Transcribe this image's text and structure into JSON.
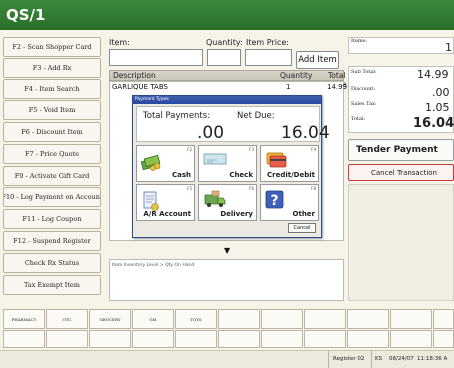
{
  "app": {
    "title": "QS/1"
  },
  "function_keys": [
    "F2 - Scan Shopper Card",
    "F3 - Add Rx",
    "F4 - Item Search",
    "F5 - Void Item",
    "F6 - Discount Item",
    "F7 - Price Quote",
    "F9 - Activate Gift Card",
    "F10 - Log Payment on Account",
    "F11 - Log Coupon",
    "F12 - Suspend Register",
    "Check Rx Status",
    "Tax Exempt Item"
  ],
  "entry": {
    "item_label": "Item:",
    "quantity_label": "Quantity:",
    "price_label": "Item Price:",
    "add_button": "Add Item",
    "item_value": "",
    "quantity_value": "",
    "price_value": ""
  },
  "items_table": {
    "columns": [
      "Description",
      "Quantity",
      "Total Price"
    ],
    "rows": [
      {
        "description": "GARLIQUE TABS",
        "quantity": "1",
        "total": "14.99"
      }
    ]
  },
  "scroll_down_arrow": "▼",
  "inventory_text": "Item Inventory Level > Qty On Hand",
  "payment_dialog": {
    "title": "Payment Types",
    "total_payments_label": "Total Payments:",
    "net_due_label": "Net Due:",
    "total_payments_value": ".00",
    "net_due_value": "16.04",
    "tiles": [
      {
        "label": "Cash",
        "key": "F2",
        "icon": "cash-icon"
      },
      {
        "label": "Check",
        "key": "F3",
        "icon": "check-icon"
      },
      {
        "label": "Credit/Debit",
        "key": "F4",
        "icon": "credit-card-icon"
      },
      {
        "label": "A/R Account",
        "key": "F5",
        "icon": "ar-account-icon"
      },
      {
        "label": "Delivery",
        "key": "F6",
        "icon": "delivery-truck-icon"
      },
      {
        "label": "Other",
        "key": "F8",
        "icon": "question-icon"
      }
    ],
    "cancel_button": "Cancel"
  },
  "totals": {
    "items_label": "Items:",
    "items_value": "1",
    "subtotal_label": "Sub Total:",
    "subtotal_value": "14.99",
    "discount_label": "Discount:",
    "discount_value": ".00",
    "tax_label": "Sales Tax:",
    "tax_value": "1.05",
    "total_label": "Total:",
    "total_value": "16.04"
  },
  "tender_button": "Tender Payment",
  "cancel_transaction_button": "Cancel Transaction",
  "categories": [
    "PHARMACY",
    "OTC",
    "GROCERY",
    "GM",
    "TOYS"
  ],
  "status": {
    "register": "Register 02",
    "user": "KS",
    "date": "08/24/07",
    "time": "11:18:36 A"
  },
  "colors": {
    "title_bar": "#2f7a2f",
    "dialog_title": "#2847a0",
    "cancel_border": "#c23a3a"
  }
}
